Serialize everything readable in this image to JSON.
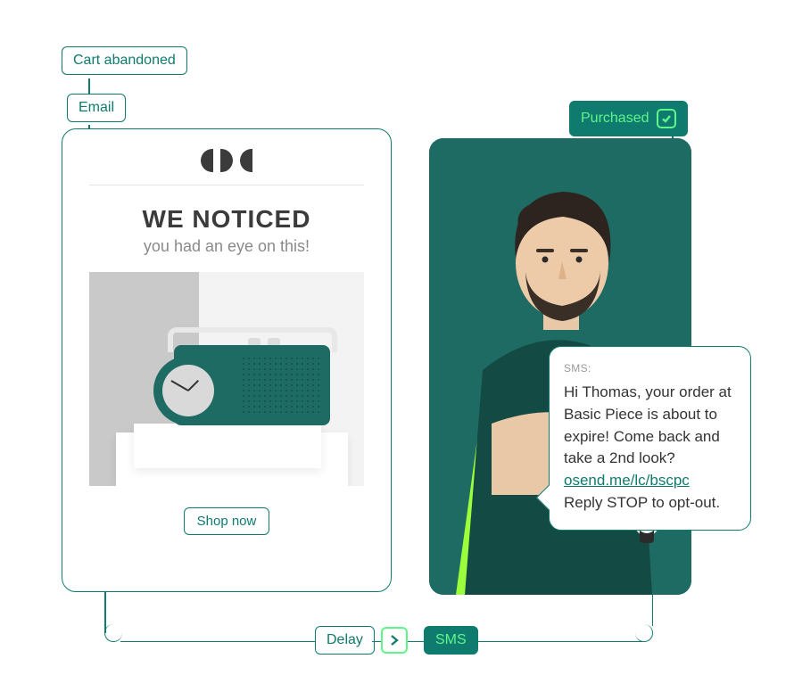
{
  "flow": {
    "trigger": "Cart abandoned",
    "email_node": "Email",
    "delay_node": "Delay",
    "sms_node": "SMS",
    "purchased_node": "Purchased"
  },
  "email": {
    "headline": "WE NOTICED",
    "subline": "you had an eye on this!",
    "cta": "Shop now"
  },
  "sms": {
    "label": "SMS:",
    "body_1": "Hi Thomas, your order at Basic Piece is about to expire! Come back and take a 2nd look?",
    "link": "osend.me/lc/bscpc",
    "body_2": "Reply STOP to opt-out."
  },
  "icons": {
    "check": "check-icon",
    "arrow": "arrow-right-icon"
  },
  "colors": {
    "teal": "#0f7a6e",
    "neon": "#5ef58a"
  }
}
